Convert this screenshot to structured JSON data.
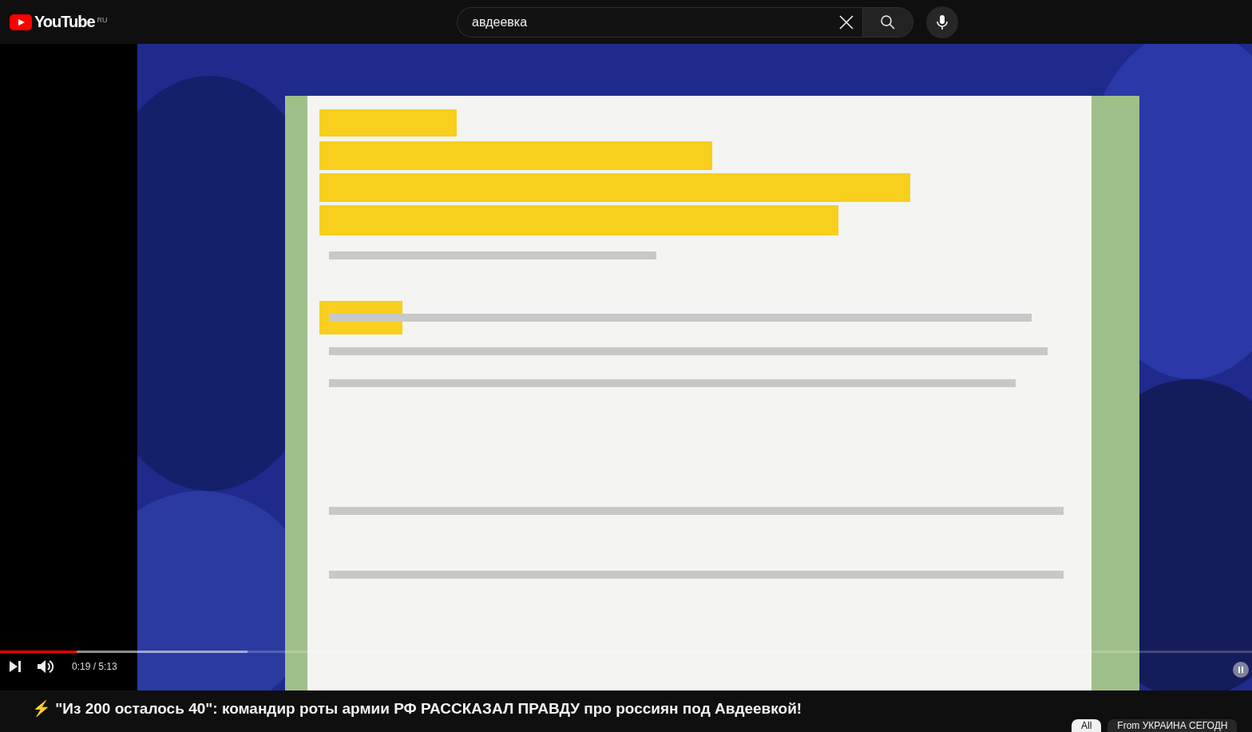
{
  "header": {
    "logo": "YouTube",
    "region": "RU",
    "search": {
      "value": "авдеевка"
    }
  },
  "player": {
    "progress": {
      "level": 0.061
    },
    "buffer": {
      "level": 0.198
    },
    "time": "0:19 / 5:13",
    "muted": false,
    "paused": false
  },
  "video_title": "⚡ \"Из 200 осталось 40\": командир роты армии РФ РАССКАЗАЛ ПРАВДУ про россиян под Авдеевкой!",
  "chips": [
    {
      "label": "All",
      "selected": true
    },
    {
      "label": "From УКРАИНА СЕГОДН",
      "selected": false
    }
  ]
}
